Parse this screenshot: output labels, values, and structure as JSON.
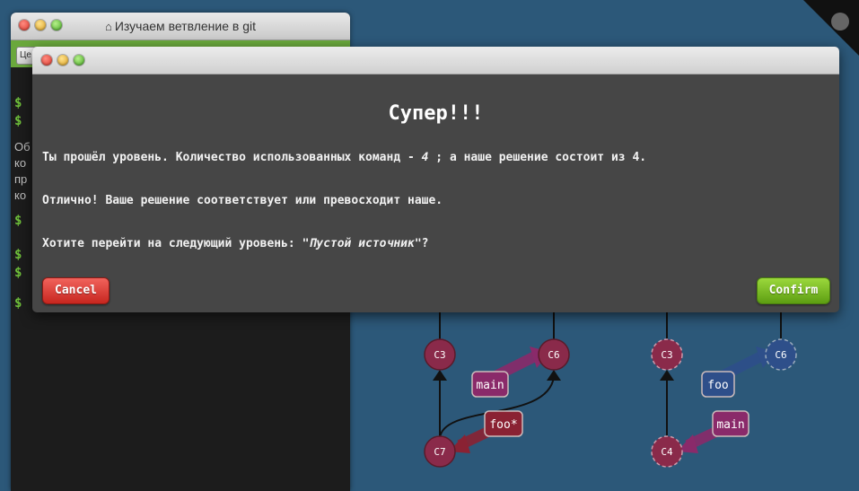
{
  "terminal": {
    "title": "Изучаем ветвление в git",
    "toolbar_button": "Це",
    "prompts": [
      "$",
      "$",
      "$",
      "$",
      "$",
      "$"
    ],
    "text_fragments": [
      "Об",
      "ко",
      "пр",
      "ко"
    ]
  },
  "modal": {
    "heading": "Супер!!!",
    "line1_prefix": "Ты прошёл уровень. Количество использованных команд - ",
    "line1_count": "4",
    "line1_suffix": " ; а наше решение состоит из 4.",
    "line2": "Отлично! Ваше решение соответствует или превосходит наше.",
    "line3_prefix": "Хотите перейти на следующий уровень: ",
    "line3_level": "\"Пустой источник\"",
    "line3_suffix": "?",
    "cancel_label": "Cancel",
    "confirm_label": "Confirm"
  },
  "graph": {
    "current": {
      "commits": [
        "C3",
        "C6",
        "C7"
      ],
      "branches": [
        "main",
        "foo*"
      ]
    },
    "goal": {
      "commits": [
        "C3",
        "C6",
        "C4"
      ],
      "branches": [
        "foo",
        "main"
      ]
    }
  },
  "colors": {
    "background": "#2c5879",
    "terminal_bg": "#1c1c1c",
    "modal_bg": "#464646",
    "cancel": "#d9362a",
    "confirm": "#7cbf26",
    "commit_fill": "#8a2a4a",
    "main_branch": "#8a2a6a",
    "foo_branch": "#8a2233",
    "goal_foo": "#2e4f8a"
  }
}
